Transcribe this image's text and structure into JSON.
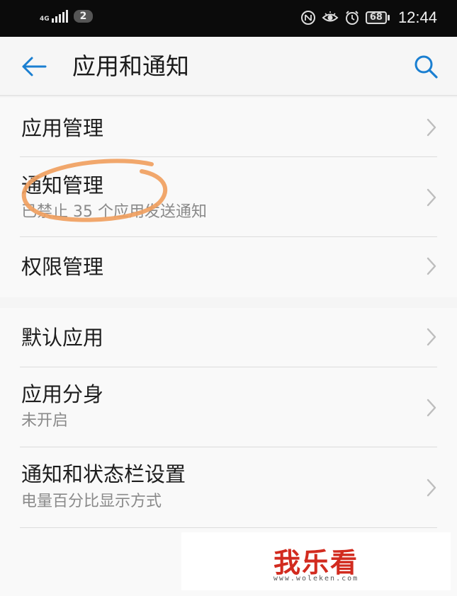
{
  "status_bar": {
    "network": "4G",
    "sim_badge": "2",
    "battery": "68",
    "time": "12:44",
    "icons": [
      "signal-icon",
      "nfc-icon",
      "eye-icon",
      "alarm-icon",
      "battery-icon"
    ]
  },
  "app_bar": {
    "title": "应用和通知",
    "back_icon": "arrow-left-icon",
    "search_icon": "search-icon",
    "accent_color": "#1a7fd1"
  },
  "group1": {
    "items": [
      {
        "title": "应用管理"
      },
      {
        "title": "通知管理",
        "subtitle": "已禁止 35 个应用发送通知"
      },
      {
        "title": "权限管理"
      }
    ]
  },
  "group2": {
    "items": [
      {
        "title": "默认应用"
      },
      {
        "title": "应用分身",
        "subtitle": "未开启"
      },
      {
        "title": "通知和状态栏设置",
        "subtitle": "电量百分比显示方式"
      }
    ]
  },
  "annotation": {
    "color": "#f0a060"
  },
  "watermark": {
    "logo": "我乐看",
    "url": "www.woleken.com"
  }
}
